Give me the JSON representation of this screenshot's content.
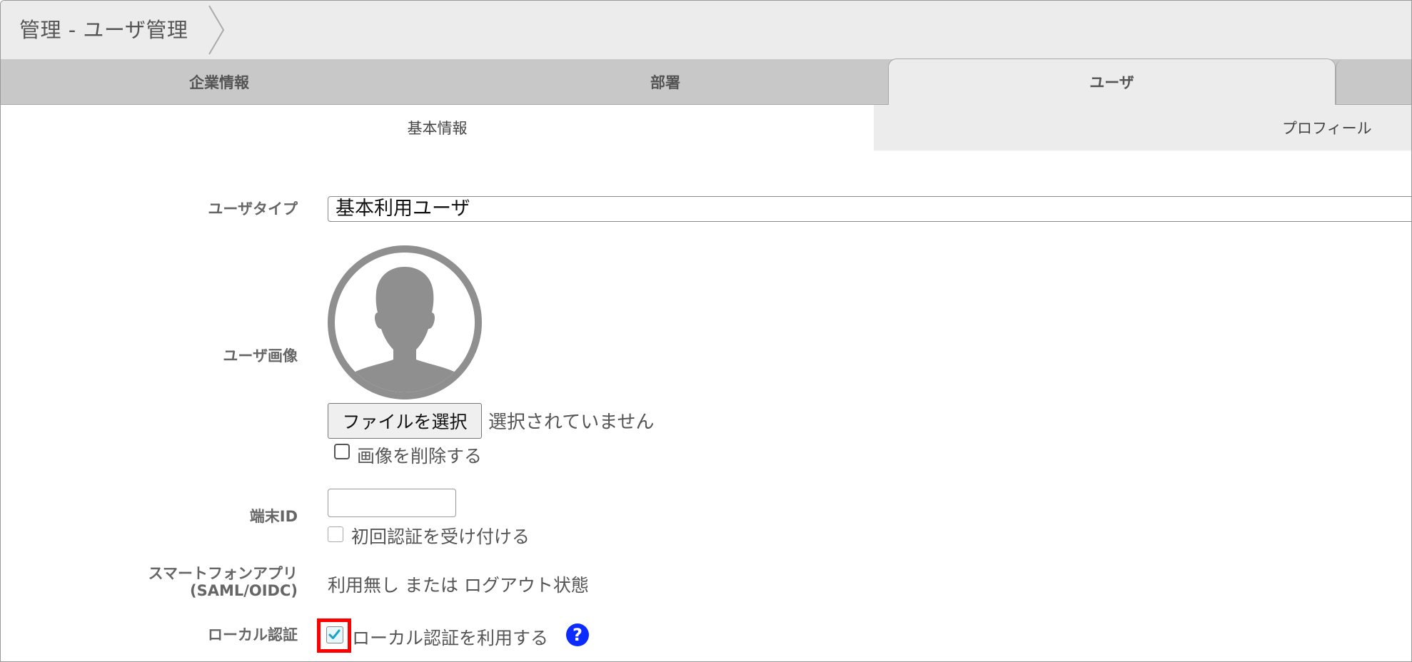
{
  "header": {
    "breadcrumb": "管理 - ユーザ管理"
  },
  "main_tabs": [
    {
      "label": "企業情報",
      "active": false
    },
    {
      "label": "部署",
      "active": false
    },
    {
      "label": "ユーザ",
      "active": true
    }
  ],
  "sub_tabs": [
    {
      "label": "基本情報",
      "active": true
    },
    {
      "label": "プロフィール",
      "active": false
    }
  ],
  "form": {
    "user_type": {
      "label": "ユーザタイプ",
      "value": "基本利用ユーザ"
    },
    "user_image": {
      "label": "ユーザ画像",
      "avatar_icon": "default-user-avatar",
      "file_button": "ファイルを選択",
      "file_status": "選択されていません",
      "delete_label": "画像を削除する",
      "delete_checked": false
    },
    "device_id": {
      "label": "端末ID",
      "value": "",
      "accept_first_auth_label": "初回認証を受け付ける",
      "accept_first_auth_checked": false
    },
    "smartphone_app": {
      "label_line1": "スマートフォンアプリ",
      "label_line2": "(SAML/OIDC)",
      "value": "利用無し または ログアウト状態"
    },
    "local_auth": {
      "label": "ローカル認証",
      "checkbox_label": "ローカル認証を利用する",
      "checked": true,
      "help_icon": "question-mark-icon",
      "help_glyph": "?"
    }
  },
  "colors": {
    "highlight": "#ff0000",
    "help_icon_bg": "#0b2bff",
    "check_mark": "#1aa3c8",
    "tab_bar": "#c8c8c8",
    "header_bg": "#ececec"
  }
}
